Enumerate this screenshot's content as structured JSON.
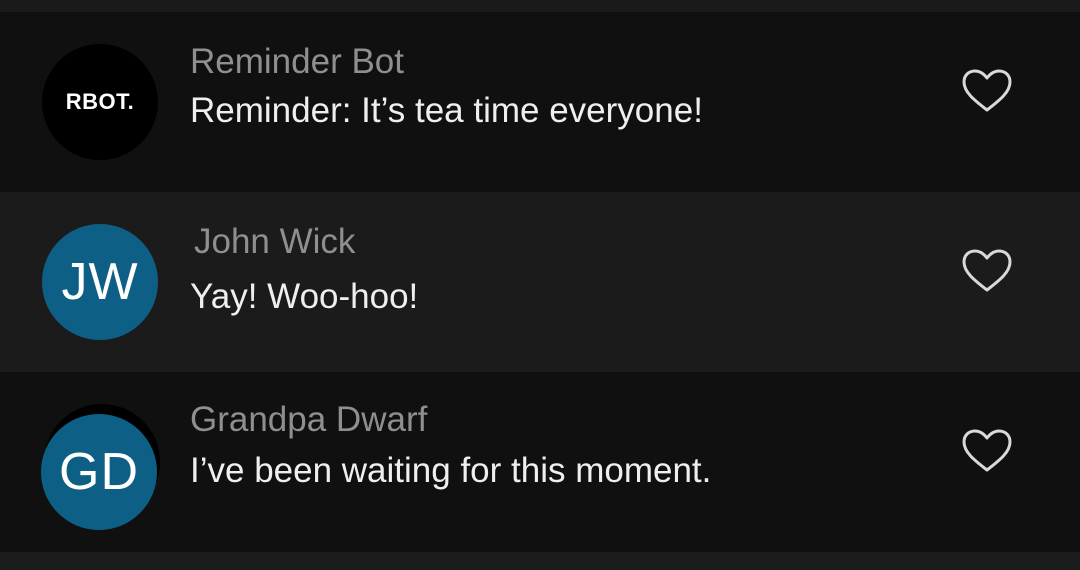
{
  "colors": {
    "background": "#181818",
    "row_dark": "#101010",
    "row_light": "#1b1b1b",
    "avatar_blue": "#0e5f86",
    "avatar_black": "#000000",
    "sender_text": "#8f8f8f",
    "message_text": "#efefef",
    "heart_outline": "#d9d9d9"
  },
  "messages": [
    {
      "avatar_text": "RBOT.",
      "sender": "Reminder Bot",
      "text": "Reminder: It’s tea time everyone!",
      "like_icon": "heart-outline-icon"
    },
    {
      "avatar_text": "JW",
      "sender": "John Wick",
      "text": "Yay! Woo-hoo!",
      "like_icon": "heart-outline-icon"
    },
    {
      "avatar_text": "GD",
      "sender": "Grandpa Dwarf",
      "text": "I’ve been waiting for this moment.",
      "like_icon": "heart-outline-icon"
    }
  ]
}
